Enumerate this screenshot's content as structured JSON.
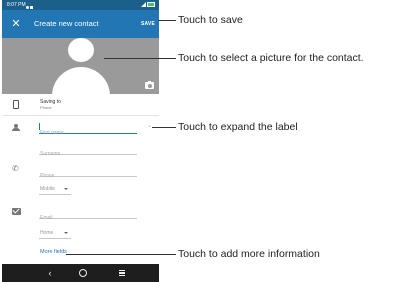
{
  "status_bar": {
    "time": "8:07 PM"
  },
  "app_bar": {
    "close_icon": "close-icon",
    "title": "Create new contact",
    "save_label": "SAVE"
  },
  "photo": {
    "camera_icon": "camera-icon",
    "avatar_icon": "person-silhouette"
  },
  "account": {
    "label": "Saving to",
    "value": "Phone"
  },
  "fields": {
    "first_name": {
      "placeholder": "First name",
      "value": ""
    },
    "surname": {
      "placeholder": "Surname",
      "value": ""
    },
    "phone": {
      "placeholder": "Phone",
      "value": ""
    },
    "phone_type": "Mobile",
    "email": {
      "placeholder": "Email",
      "value": ""
    },
    "email_type": "Home"
  },
  "more_fields_label": "More fields",
  "callouts": {
    "save": "Touch to save",
    "picture": "Touch to select a picture for the contact.",
    "expand": "Touch to expand the label",
    "more": "Touch to add more information"
  },
  "colors": {
    "app_bar": "#2276b3",
    "status_bar": "#1b5f8b",
    "accent": "#2276b3",
    "nav_bar": "#1e1e1e"
  }
}
